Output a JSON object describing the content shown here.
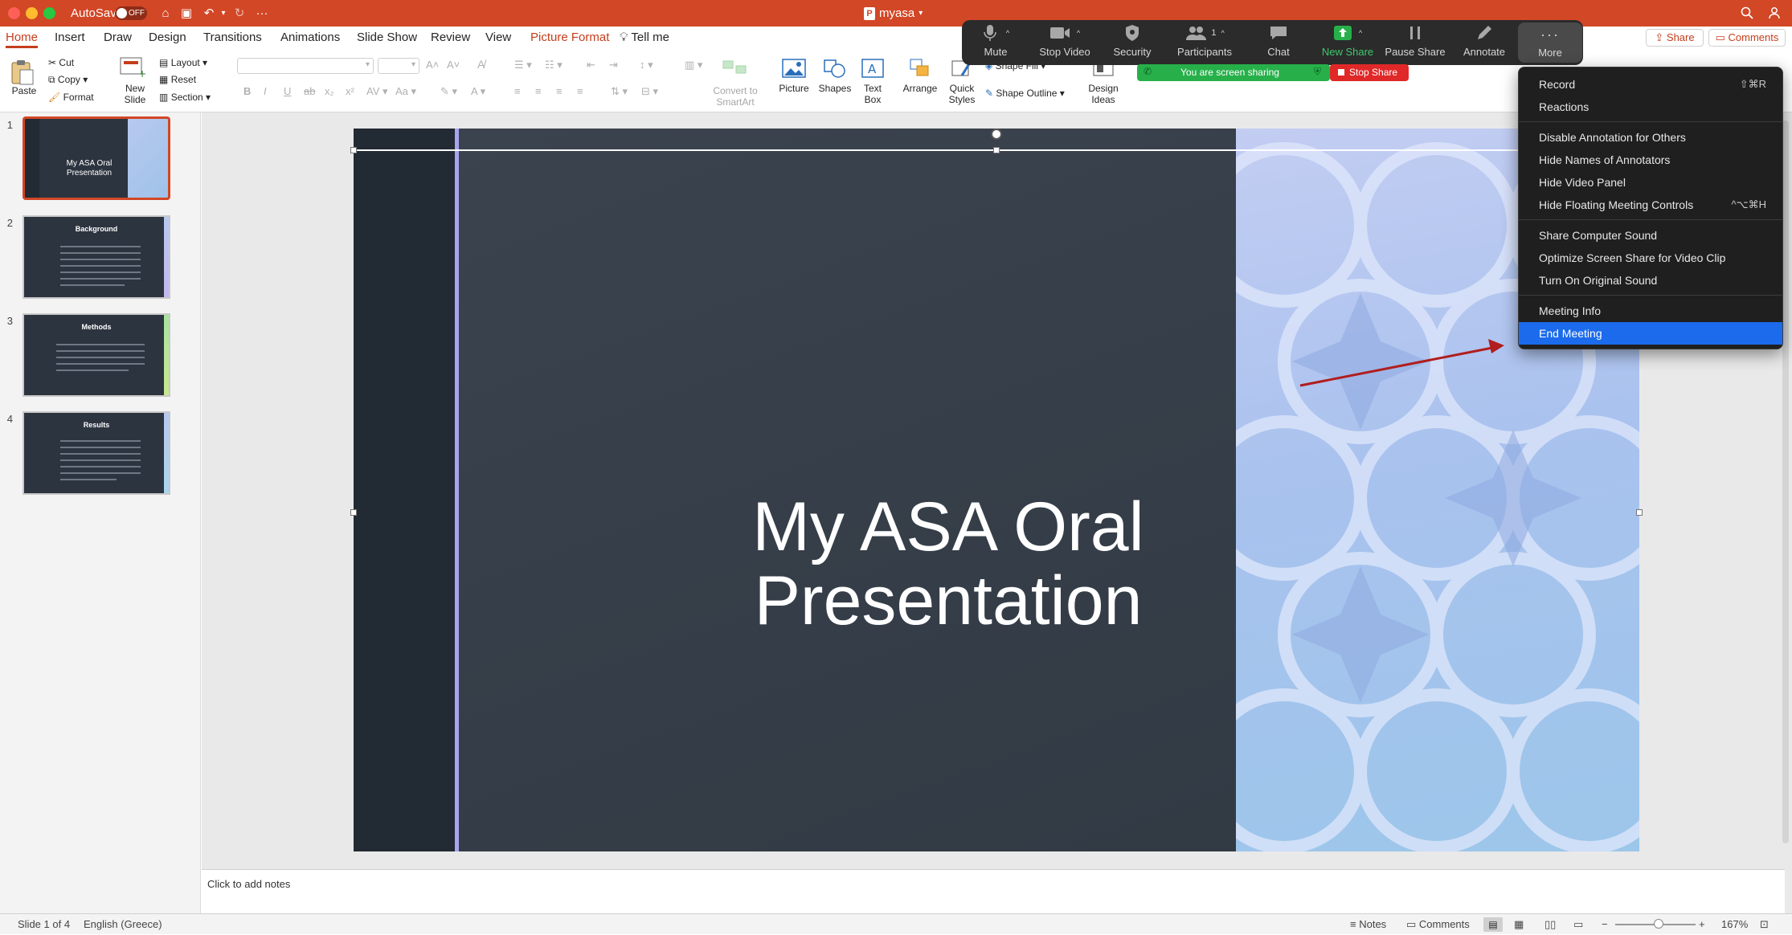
{
  "window": {
    "autosave_label": "AutoSave",
    "autosave_state": "OFF",
    "doc_title": "myasa"
  },
  "ribbon_tabs": [
    {
      "label": "Home",
      "active": true
    },
    {
      "label": "Insert"
    },
    {
      "label": "Draw"
    },
    {
      "label": "Design"
    },
    {
      "label": "Transitions"
    },
    {
      "label": "Animations"
    },
    {
      "label": "Slide Show"
    },
    {
      "label": "Review"
    },
    {
      "label": "View"
    },
    {
      "label": "Picture Format",
      "accent": true
    },
    {
      "label": "Tell me"
    }
  ],
  "top_right": {
    "share": "Share",
    "comments": "Comments"
  },
  "ribbon": {
    "paste": "Paste",
    "cut": "Cut",
    "copy": "Copy",
    "format": "Format",
    "new_slide": [
      "New",
      "Slide"
    ],
    "layout": "Layout",
    "reset": "Reset",
    "section": "Section",
    "convert_smartart": [
      "Convert to",
      "SmartArt"
    ],
    "picture": "Picture",
    "shapes": "Shapes",
    "text_box": [
      "Text",
      "Box"
    ],
    "arrange": "Arrange",
    "quick_styles": [
      "Quick",
      "Styles"
    ],
    "shape_fill": "Shape Fill",
    "shape_outline": "Shape Outline",
    "design_ideas": [
      "Design",
      "Ideas"
    ]
  },
  "zoom": {
    "controls": [
      {
        "label": "Mute",
        "icon": "mic-icon"
      },
      {
        "label": "Stop Video",
        "icon": "video-icon"
      },
      {
        "label": "Security",
        "icon": "shield-icon"
      },
      {
        "label": "Participants",
        "icon": "participants-icon",
        "count": "1"
      },
      {
        "label": "Chat",
        "icon": "chat-icon"
      },
      {
        "label": "New Share",
        "icon": "share-icon"
      },
      {
        "label": "Pause Share",
        "icon": "pause-icon"
      },
      {
        "label": "Annotate",
        "icon": "pencil-icon"
      },
      {
        "label": "More",
        "icon": "more-icon"
      }
    ],
    "sharing_banner": "You are screen sharing",
    "stop_share": "Stop Share",
    "more_menu": [
      {
        "label": "Record",
        "shortcut": "⇧⌘R"
      },
      {
        "label": "Reactions"
      },
      {
        "label": "Disable Annotation for Others"
      },
      {
        "label": "Hide Names of Annotators"
      },
      {
        "label": "Hide Video Panel"
      },
      {
        "label": "Hide Floating Meeting Controls",
        "shortcut": "^⌥⌘H"
      },
      {
        "label": "Share Computer Sound"
      },
      {
        "label": "Optimize Screen Share for Video Clip"
      },
      {
        "label": "Turn On Original Sound"
      },
      {
        "label": "Meeting Info"
      },
      {
        "label": "End Meeting",
        "highlighted": true
      }
    ]
  },
  "thumbnails": [
    {
      "num": "1",
      "title": "My ASA Oral Presentation",
      "selected": true
    },
    {
      "num": "2",
      "title": "Background"
    },
    {
      "num": "3",
      "title": "Methods"
    },
    {
      "num": "4",
      "title": "Results"
    }
  ],
  "slide": {
    "title_line1": "My ASA Oral",
    "title_line2": "Presentation"
  },
  "notes_placeholder": "Click to add notes",
  "status": {
    "slide_of": "Slide 1 of 4",
    "language": "English (Greece)",
    "notes": "Notes",
    "comments": "Comments",
    "zoom": "167%"
  },
  "colors": {
    "titlebar": "#d24726",
    "accent": "#c43e1c",
    "slide_dark": "#37404a",
    "slide_pattern": "#a9c4ec",
    "menu_highlight": "#1b6bec",
    "share_green": "#27b04a",
    "stop_red": "#e02828"
  }
}
